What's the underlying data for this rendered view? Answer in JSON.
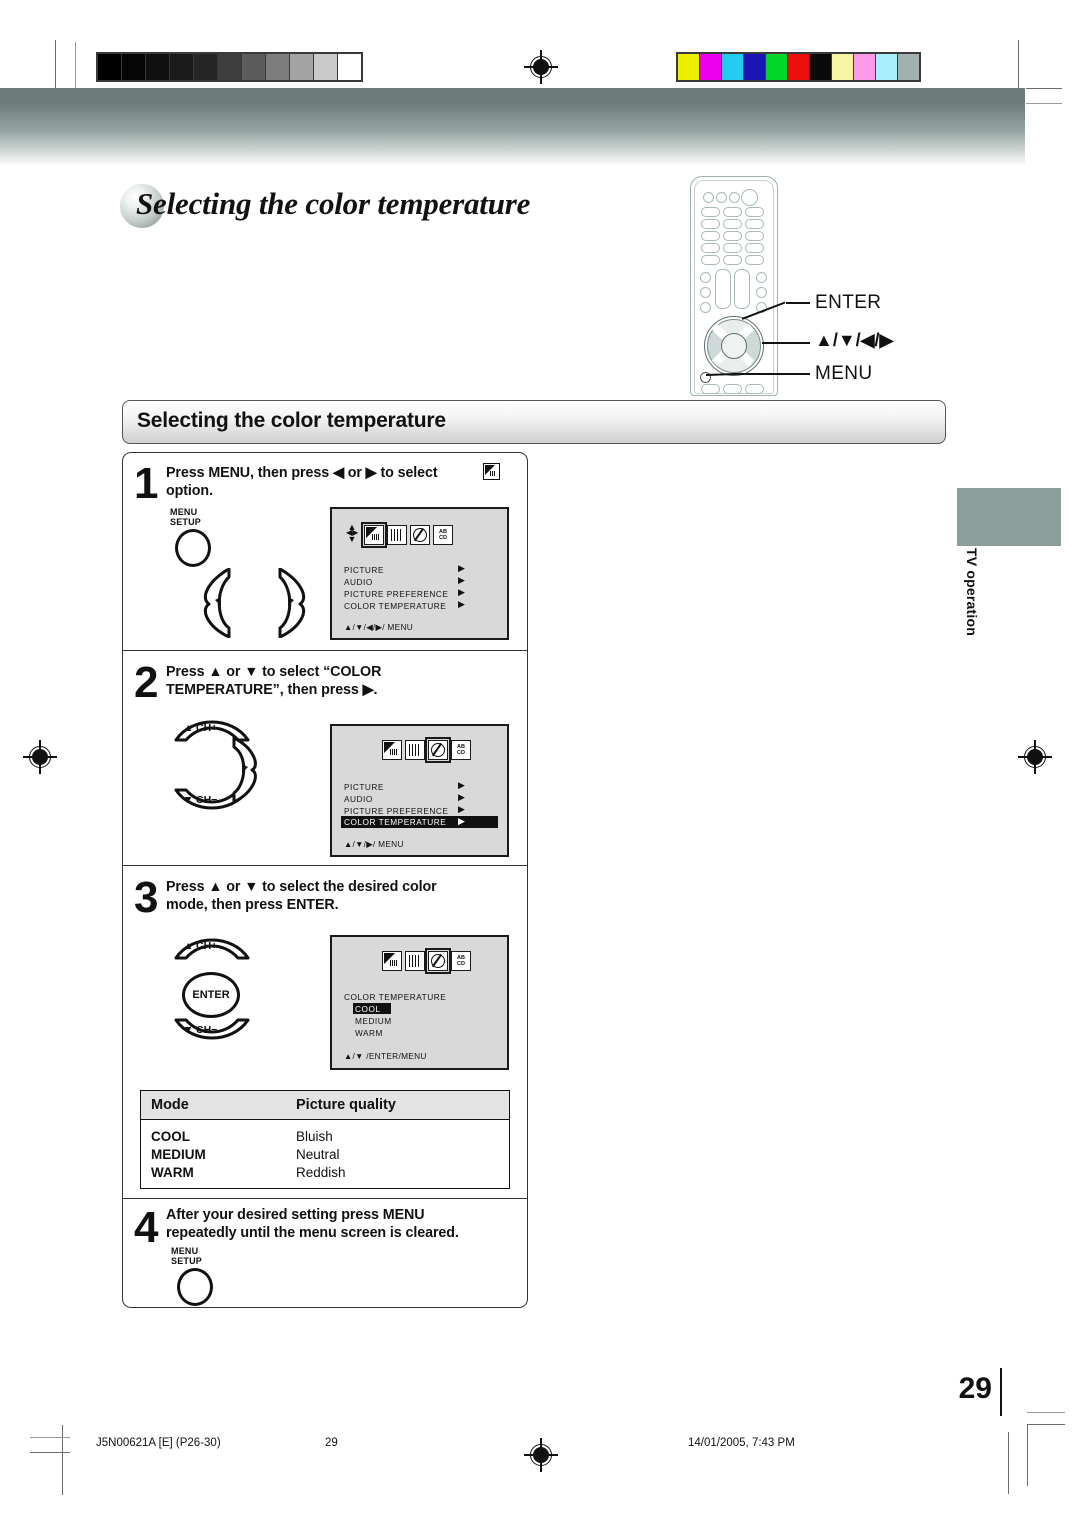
{
  "document": {
    "page_title": "Selecting the color temperature",
    "section_heading": "Selecting the color temperature",
    "page_number": "29",
    "side_tab_label": "TV operation"
  },
  "remote_callouts": [
    {
      "name": "enter",
      "label": "ENTER"
    },
    {
      "name": "direction",
      "label": "▲/▼/◀/▶"
    },
    {
      "name": "menu",
      "label": "MENU"
    }
  ],
  "steps": [
    {
      "number": "1",
      "line1": "Press MENU, then press ◀ or ▶ to select",
      "line2": "option.",
      "key_label_line1": "MENU",
      "key_label_line2": "SETUP",
      "left_arrow": "◀",
      "right_arrow": "▶"
    },
    {
      "number": "2",
      "line1": "Press ▲ or ▼ to select “COLOR",
      "line2": "TEMPERATURE”, then press ▶.",
      "ch_up": "CH+",
      "ch_down": "CH−",
      "right_arrow": "▶"
    },
    {
      "number": "3",
      "line1": "Press ▲ or ▼ to select the desired color",
      "line2": "mode, then press ENTER.",
      "ch_up": "CH+",
      "ch_down": "CH−",
      "enter_label": "ENTER"
    },
    {
      "number": "4",
      "line1": "After your desired setting press MENU",
      "line2": "repeatedly until the menu screen is cleared.",
      "key_label_line1": "MENU",
      "key_label_line2": "SETUP"
    }
  ],
  "osd1": {
    "icons": [
      "picture-icon",
      "grid-icon",
      "prohibit-icon",
      "abcd-icon"
    ],
    "selected_icon_index": 0,
    "items": [
      "PICTURE",
      "AUDIO",
      "PICTURE  PREFERENCE",
      "COLOR  TEMPERATURE"
    ],
    "arrow": "▶",
    "highlighted_index": -1,
    "footer": "▲/▼/◀/▶/ MENU"
  },
  "osd2": {
    "icons": [
      "picture-icon",
      "grid-icon",
      "prohibit-icon",
      "abcd-icon"
    ],
    "selected_icon_index": 2,
    "items": [
      "PICTURE",
      "AUDIO",
      "PICTURE  PREFERENCE",
      "COLOR  TEMPERATURE"
    ],
    "arrow": "▶",
    "highlighted_index": 3,
    "footer": "▲/▼/▶/ MENU"
  },
  "osd3": {
    "icons": [
      "picture-icon",
      "grid-icon",
      "prohibit-icon",
      "abcd-icon"
    ],
    "selected_icon_index": 2,
    "title": "COLOR  TEMPERATURE",
    "options": [
      "COOL",
      "MEDIUM",
      "WARM"
    ],
    "selected_option_index": 0,
    "footer": "▲/▼ /ENTER/MENU"
  },
  "mode_table": {
    "headers": [
      "Mode",
      "Picture quality"
    ],
    "rows": [
      {
        "mode": "COOL",
        "quality": "Bluish"
      },
      {
        "mode": "MEDIUM",
        "quality": "Neutral"
      },
      {
        "mode": "WARM",
        "quality": "Reddish"
      }
    ]
  },
  "print_footer": {
    "job_id": "J5N00621A [E] (P26-30)",
    "page": "29",
    "timestamp": "14/01/2005, 7:43 PM"
  },
  "calibration": {
    "gray_bars": [
      "#000000",
      "#050505",
      "#101010",
      "#1a1a1a",
      "#262626",
      "#3d3d3d",
      "#5c5c5c",
      "#7d7d7d",
      "#a3a3a3",
      "#c9c9c9",
      "#ffffff"
    ],
    "color_bars": [
      "#eeee00",
      "#ee00ee",
      "#22ccee",
      "#1a14b4",
      "#00d62a",
      "#ee0d0d",
      "#0a0a0a",
      "#f7f5a3",
      "#fb9ae8",
      "#a8eefb",
      "#a3b0b0"
    ]
  }
}
